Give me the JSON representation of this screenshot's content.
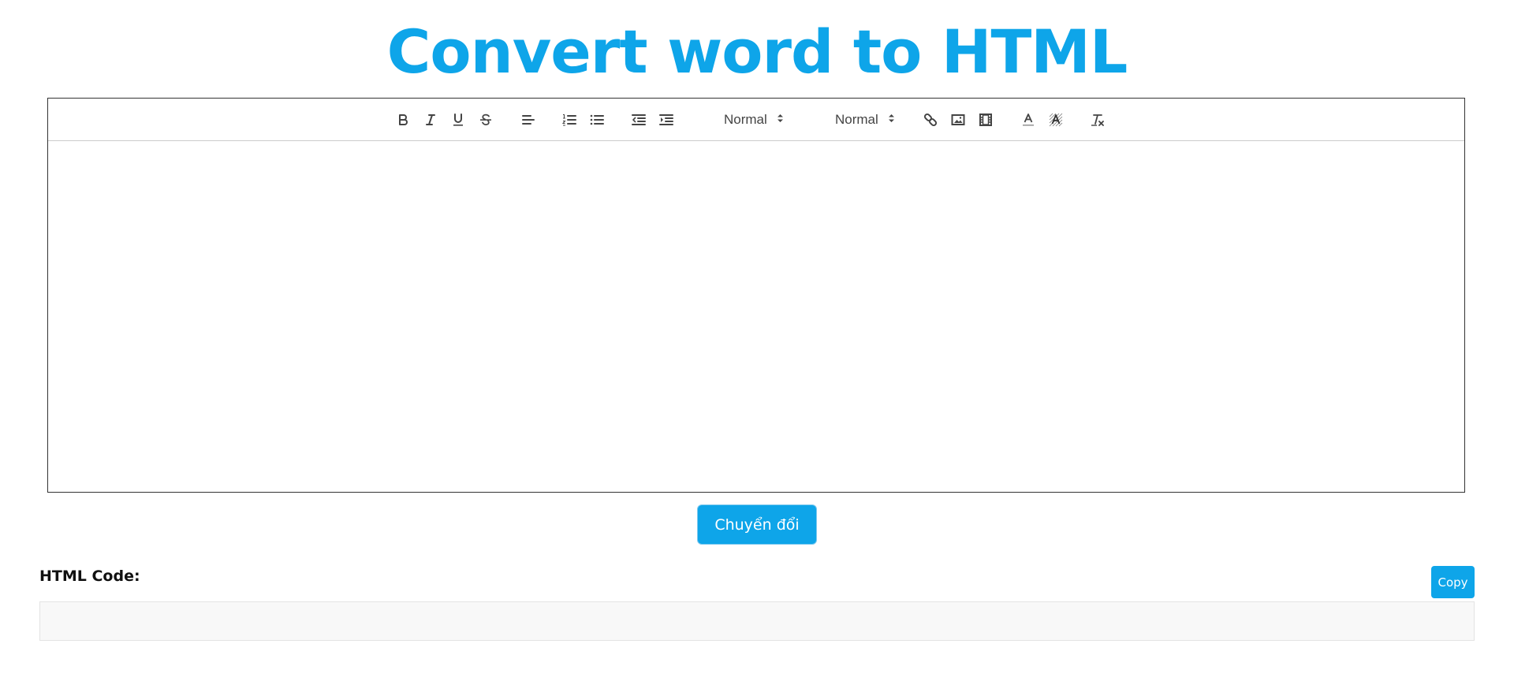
{
  "title": "Convert word to HTML",
  "toolbar": {
    "size_select": "Normal",
    "header_select": "Normal",
    "icons": [
      "bold-icon",
      "italic-icon",
      "underline-icon",
      "strike-icon",
      "align-left-icon",
      "ordered-list-icon",
      "bullet-list-icon",
      "outdent-icon",
      "indent-icon",
      "link-icon",
      "image-icon",
      "video-icon",
      "text-color-icon",
      "background-color-icon",
      "clear-format-icon"
    ],
    "icon_color": "#444444"
  },
  "editor": {
    "content": ""
  },
  "convert_button": "Chuyển đổi",
  "output": {
    "label": "HTML Code:",
    "copy_button": "Copy",
    "code": ""
  },
  "colors": {
    "accent": "#0ea5e9"
  }
}
